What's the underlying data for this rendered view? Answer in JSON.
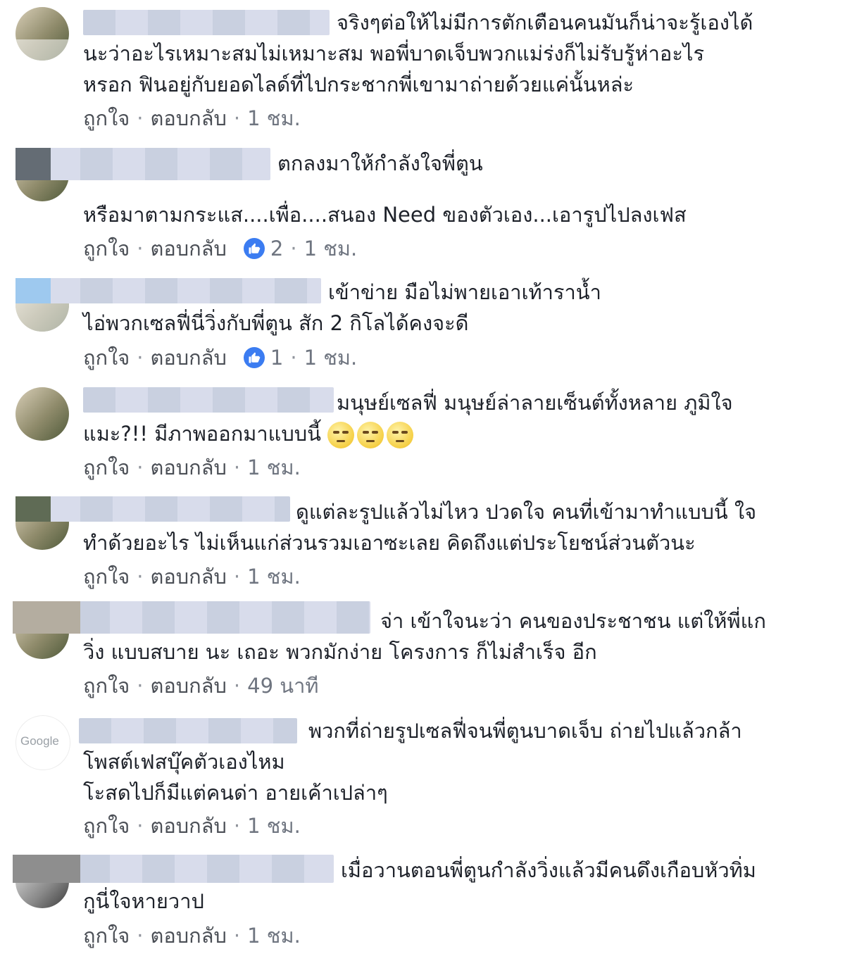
{
  "actions": {
    "like": "ถูกใจ",
    "reply": "ตอบกลับ",
    "dot": "·"
  },
  "comments": [
    {
      "text": "จริงๆต่อให้ไม่มีการตักเตือนคนมันก็น่าจะรู้เองได้\nนะว่าอะไรเหมาะสมไม่เหมาะสม พอพี่บาดเจ็บพวกแม่ร่งก็ไม่รับรู้ห่าอะไร\nหรอก ฟินอยู่กับยอดไลด์ที่ไปกระชากพี่เขามาถ่ายด้วยแค่นั้นหล่ะ",
      "reactions": null,
      "time": "1 ชม."
    },
    {
      "text": "ตกลงมาให้กำลังใจพี่ตูน",
      "text2": "หรือมาตามกระแส....เพื่อ....สนอง Need ของตัวเอง...เอารูปไปลงเฟส",
      "reactions": "2",
      "time": "1 ชม."
    },
    {
      "text": "เข้าข่าย มือไม่พายเอาเท้าราน้ำ\nไอ่พวกเซลฟี่นี่วิ่งกับพี่ตูน สัก 2 กิโลได้คงจะดี",
      "reactions": "1",
      "time": "1 ชม."
    },
    {
      "text": "มนุษย์เซลฟี่ มนุษย์ล่าลายเซ็นต์ทั้งหลาย ภูมิใจ\nแมะ?!! มีภาพออกมาแบบนี้ ",
      "emoji_count": 3,
      "reactions": null,
      "time": "1 ชม."
    },
    {
      "text": "ดูแต่ละรูปแล้วไม่ไหว ปวดใจ คนที่เข้ามาทำแบบนี้ ใจ\nทำด้วยอะไร ไม่เห็นแก่ส่วนรวมเอาซะเลย คิดถึงแต่ประโยชน์ส่วนตัวนะ",
      "reactions": null,
      "time": "1 ชม."
    },
    {
      "text": "จ่า เข้าใจนะว่า คนของประชาชน แต่ให้พี่แก\nวิ่ง แบบสบาย นะ เถอะ พวกมักง่าย โครงการ ก็ไม่สำเร็จ อีก",
      "reactions": null,
      "time": "49 นาที"
    },
    {
      "text": "พวกที่ถ่ายรูปเซลฟี่จนพี่ตูนบาดเจ็บ ถ่ายไปแล้วกล้า\nโพสต์เฟสบุ๊คตัวเองไหม\nโะสดไปก็มีแต่คนด่า อายเค้าเปล่าๆ",
      "avatar_text": "Google",
      "reactions": null,
      "time": "1 ชม."
    },
    {
      "text": "เมื่อวานตอนพี่ตูนกำลังวิ่งแล้วมีคนดึงเกือบหัวทิ่ม\nกูนี่ใจหายวาป",
      "reactions": null,
      "time": "1 ชม."
    }
  ]
}
